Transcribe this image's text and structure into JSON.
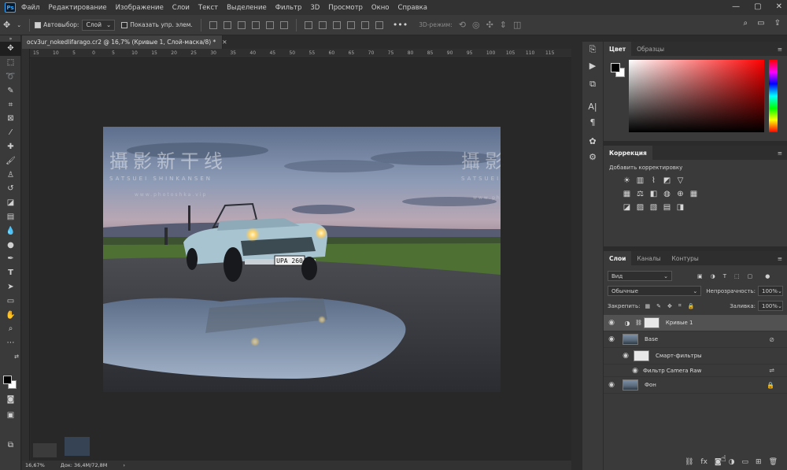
{
  "menubar": {
    "app_badge": "Ps",
    "items": [
      "Файл",
      "Редактирование",
      "Изображение",
      "Слои",
      "Текст",
      "Выделение",
      "Фильтр",
      "3D",
      "Просмотр",
      "Окно",
      "Справка"
    ],
    "win": [
      "—",
      "▢",
      "✕"
    ]
  },
  "options": {
    "autoselect_label": "Автовыбор:",
    "autoselect_value": "Слой",
    "show_transform_label": "Показать упр. элем.",
    "mode3d_label": "3D-режим:"
  },
  "document": {
    "tab_title": "ocv3ur_nokedlifarago.cr2 @ 16,7% (Кривые 1, Слой-маска/8) *",
    "ruler_ticks": [
      "15",
      "10",
      "5",
      "0",
      "5",
      "10",
      "15",
      "20",
      "25",
      "30",
      "35",
      "40",
      "45",
      "50",
      "55",
      "60",
      "65",
      "70",
      "75",
      "80",
      "85",
      "90",
      "95",
      "100",
      "105",
      "110",
      "115"
    ],
    "zoom": "16,67%",
    "doc_info": "Док: 36,4M/72,8M",
    "watermark_cn": "攝影新干线",
    "watermark_en": "SATSUEI SHINKANSEN",
    "watermark_url": "www.photoshka.vip",
    "plate": "UPA 260"
  },
  "color_panel": {
    "tabs": [
      "Цвет",
      "Образцы"
    ],
    "fg": "#000000",
    "bg": "#ffffff",
    "hue": "#ff0000"
  },
  "adjustments": {
    "tab": "Коррекция",
    "title": "Добавить корректировку"
  },
  "layers_panel": {
    "tabs": [
      "Слои",
      "Каналы",
      "Контуры"
    ],
    "kind_filter": "Вид",
    "blend_mode": "Обычные",
    "opacity_label": "Непрозрачность:",
    "opacity_value": "100%",
    "lock_label": "Закрепить:",
    "fill_label": "Заливка:",
    "fill_value": "100%",
    "layers": [
      {
        "name": "Кривые 1"
      },
      {
        "name": "Base"
      },
      {
        "name": "Смарт-фильтры"
      },
      {
        "name": "Фильтр Camera Raw"
      },
      {
        "name": "Фон"
      }
    ]
  }
}
